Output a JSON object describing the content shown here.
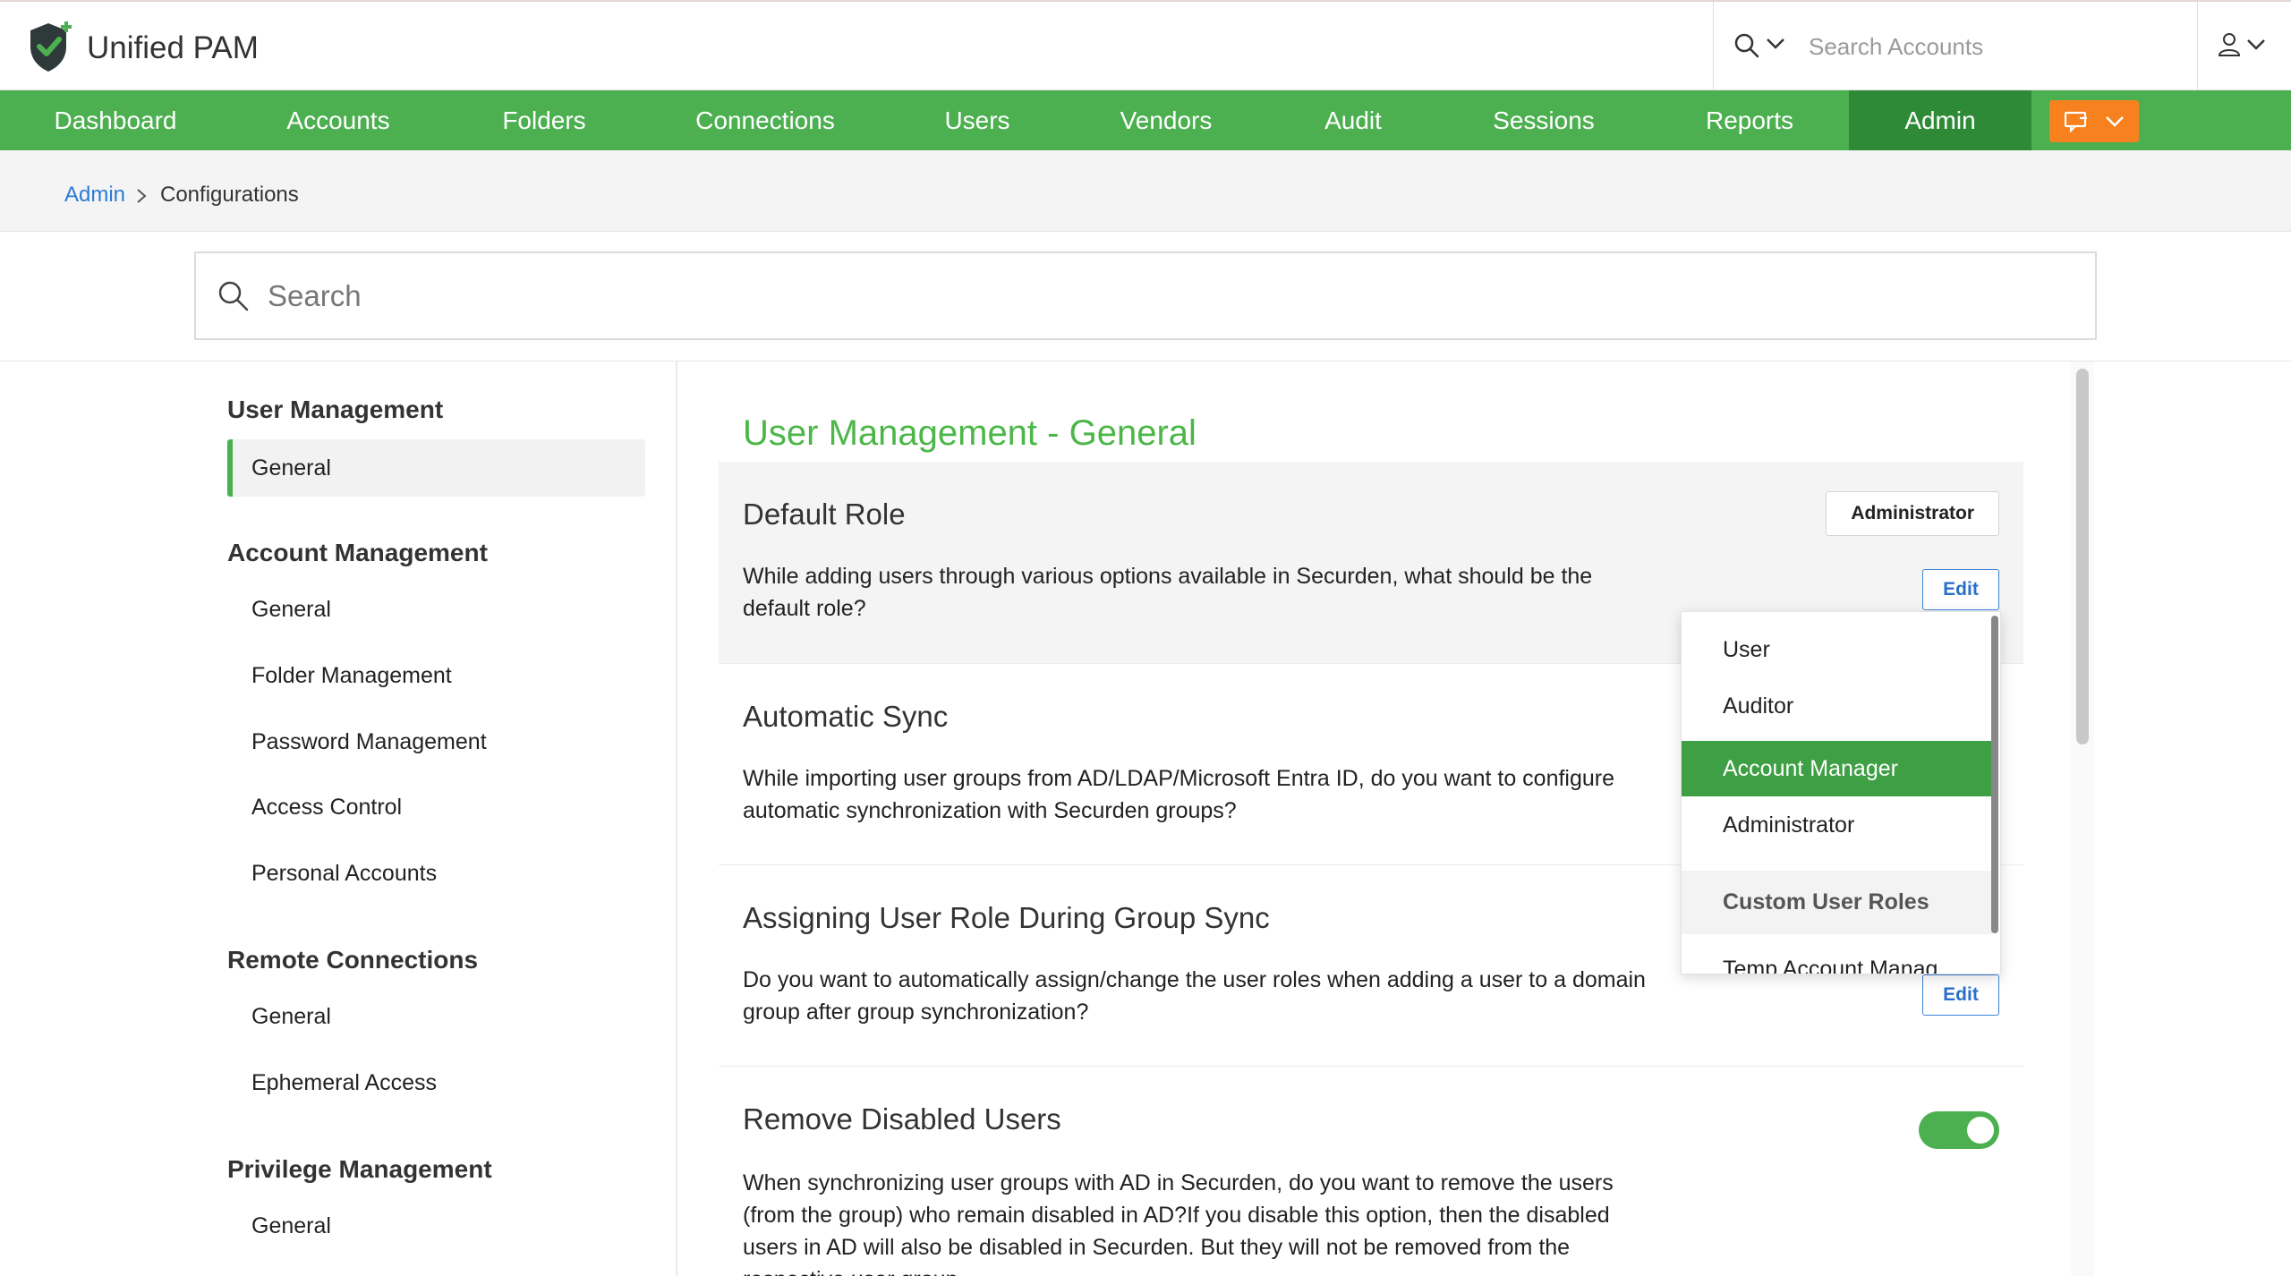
{
  "app": {
    "title": "Unified PAM"
  },
  "header": {
    "search_placeholder": "Search Accounts"
  },
  "nav": {
    "items": [
      {
        "label": "Dashboard"
      },
      {
        "label": "Accounts"
      },
      {
        "label": "Folders"
      },
      {
        "label": "Connections"
      },
      {
        "label": "Users"
      },
      {
        "label": "Vendors"
      },
      {
        "label": "Audit"
      },
      {
        "label": "Sessions"
      },
      {
        "label": "Reports"
      },
      {
        "label": "Admin",
        "active": true
      }
    ],
    "accent_color": "#4caf50",
    "active_color": "#2f8a38",
    "quick_button_color": "#f7811e"
  },
  "breadcrumb": {
    "root": "Admin",
    "current": "Configurations"
  },
  "config_search": {
    "placeholder": "Search"
  },
  "sidebar": {
    "groups": [
      {
        "heading": "User Management",
        "items": [
          {
            "label": "General",
            "active": true
          }
        ]
      },
      {
        "heading": "Account Management",
        "items": [
          {
            "label": "General"
          },
          {
            "label": "Folder Management"
          },
          {
            "label": "Password Management"
          },
          {
            "label": "Access Control"
          },
          {
            "label": "Personal Accounts"
          }
        ]
      },
      {
        "heading": "Remote Connections",
        "items": [
          {
            "label": "General"
          },
          {
            "label": "Ephemeral Access"
          }
        ]
      },
      {
        "heading": "Privilege Management",
        "items": [
          {
            "label": "General"
          }
        ]
      }
    ]
  },
  "main": {
    "title": "User Management - General",
    "sections": [
      {
        "title": "Default Role",
        "desc": "While adding users through various options available in Securden, what should be the default role?",
        "value": "Administrator",
        "edit_label": "Edit"
      },
      {
        "title": "Automatic Sync",
        "desc": "While importing user groups from AD/LDAP/Microsoft Entra ID, do you want to configure automatic synchronization with Securden groups?"
      },
      {
        "title": "Assigning User Role During Group Sync",
        "desc": "Do you want to automatically assign/change the user roles when adding a user to a domain group after group synchronization?",
        "edit_label": "Edit"
      },
      {
        "title": "Remove Disabled Users",
        "desc": "When synchronizing user groups with AD in Securden, do you want to remove the users (from the group) who remain disabled in AD?If you disable this option, then the disabled users in AD will also be disabled in Securden. But they will not be removed from the respective user group.",
        "toggle_on": true
      }
    ]
  },
  "role_dropdown": {
    "options": [
      "User",
      "Auditor",
      "Account Manager",
      "Administrator"
    ],
    "selected": "Account Manager",
    "group_label": "Custom User Roles",
    "custom_options": [
      "Temp Account Manag"
    ]
  }
}
